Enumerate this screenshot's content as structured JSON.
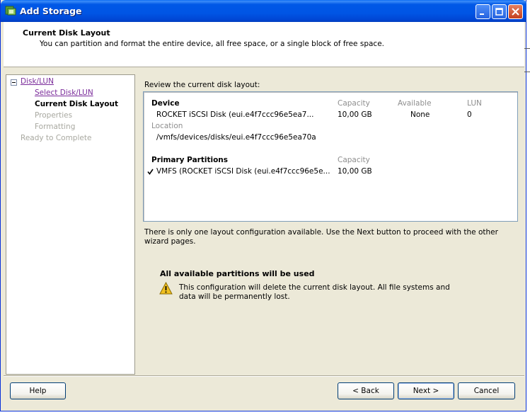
{
  "window": {
    "title": "Add Storage"
  },
  "header": {
    "title": "Current Disk Layout",
    "subtitle": "You can partition and format the entire device, all free space, or a single block of free space."
  },
  "nav": {
    "items": [
      {
        "label": "Disk/LUN",
        "state": "link"
      },
      {
        "label": "Select Disk/LUN",
        "state": "link"
      },
      {
        "label": "Current Disk Layout",
        "state": "current"
      },
      {
        "label": "Properties",
        "state": "disabled"
      },
      {
        "label": "Formatting",
        "state": "disabled"
      },
      {
        "label": "Ready to Complete",
        "state": "disabled"
      }
    ]
  },
  "main": {
    "review_label": "Review the current disk layout:",
    "device": {
      "heading": "Device",
      "col_capacity": "Capacity",
      "col_available": "Available",
      "col_lun": "LUN",
      "name": "ROCKET iSCSI Disk (eui.e4f7ccc96e5ea7...",
      "capacity": "10,00 GB",
      "available": "None",
      "lun": "0",
      "location_label": "Location",
      "location": "/vmfs/devices/disks/eui.e4f7ccc96e5ea70a"
    },
    "partitions": {
      "heading": "Primary Partitions",
      "col_capacity": "Capacity",
      "name": "VMFS (ROCKET iSCSI Disk (eui.e4f7ccc96e5e...",
      "capacity": "10,00 GB"
    },
    "info": "There is only one layout configuration available. Use the Next button to proceed with the other wizard pages.",
    "warning_title": "All available partitions will be used",
    "warning_text": "This configuration will delete the current disk layout. All file systems and data will be permanently lost."
  },
  "buttons": {
    "help": "Help",
    "back": "< Back",
    "next": "Next >",
    "cancel": "Cancel"
  },
  "colors": {
    "titlebar": "#0055e5",
    "dialog_bg": "#ece9d8",
    "visited_link": "#7a2b9a",
    "disabled_text": "#a8a8a0",
    "warning_icon": "#f0c020"
  }
}
